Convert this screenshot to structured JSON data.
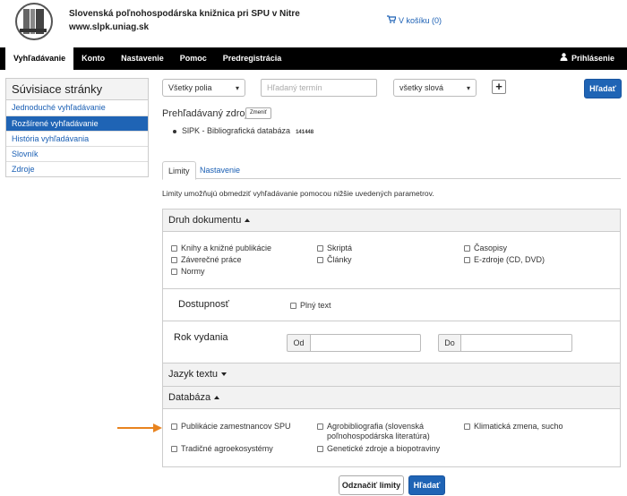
{
  "header": {
    "title": "Slovenská poľnohospodárska knižnica pri SPU v Nitre",
    "url": "www.slpk.uniag.sk",
    "cart": "V košíku (0)"
  },
  "nav": {
    "items": [
      "Vyhľadávanie",
      "Konto",
      "Nastavenie",
      "Pomoc",
      "Predregistrácia"
    ],
    "login": "Prihlásenie"
  },
  "sidebar": {
    "title": "Súvisiace stránky",
    "items": [
      "Jednoduché vyhľadávanie",
      "Rozšírené vyhľadávanie",
      "História vyhľadávania",
      "Slovník",
      "Zdroje"
    ]
  },
  "search": {
    "field_select": "Všetky polia",
    "term_placeholder": "Hľadaný termín",
    "mode_select": "všetky slová",
    "add": "+",
    "submit": "Hľadať"
  },
  "source": {
    "label": "Prehľadávaný zdroj",
    "change": "Zmeniť",
    "item": "SlPK - Bibliografická databáza",
    "count": "141448"
  },
  "tabs": [
    "Limity",
    "Nastavenie"
  ],
  "description": "Limity umožňujú obmedziť vyhľadávanie pomocou nižšie uvedených parametrov.",
  "doc_type": {
    "title": "Druh dokumentu",
    "options": [
      "Knihy a knižné publikácie",
      "Záverečné práce",
      "Normy",
      "Skriptá",
      "Články",
      "Časopisy",
      "E-zdroje (CD, DVD)"
    ]
  },
  "availability": {
    "title": "Dostupnosť",
    "option": "Plný text"
  },
  "year": {
    "title": "Rok vydania",
    "from": "Od",
    "to": "Do"
  },
  "language": {
    "title": "Jazyk textu"
  },
  "database": {
    "title": "Databáza",
    "options": [
      "Publikácie zamestnancov SPU",
      "Tradičné agroekosystémy",
      "Agrobibliografia (slovenská poľnohospodárska literatúra)",
      "Genetické zdroje a biopotraviny",
      "Klimatická zmena, sucho"
    ]
  },
  "footer": {
    "clear": "Odznačiť limity",
    "submit": "Hľadať"
  },
  "colors": {
    "primary": "#1f64b5",
    "nav": "#000000",
    "arrow": "#e8831f"
  }
}
